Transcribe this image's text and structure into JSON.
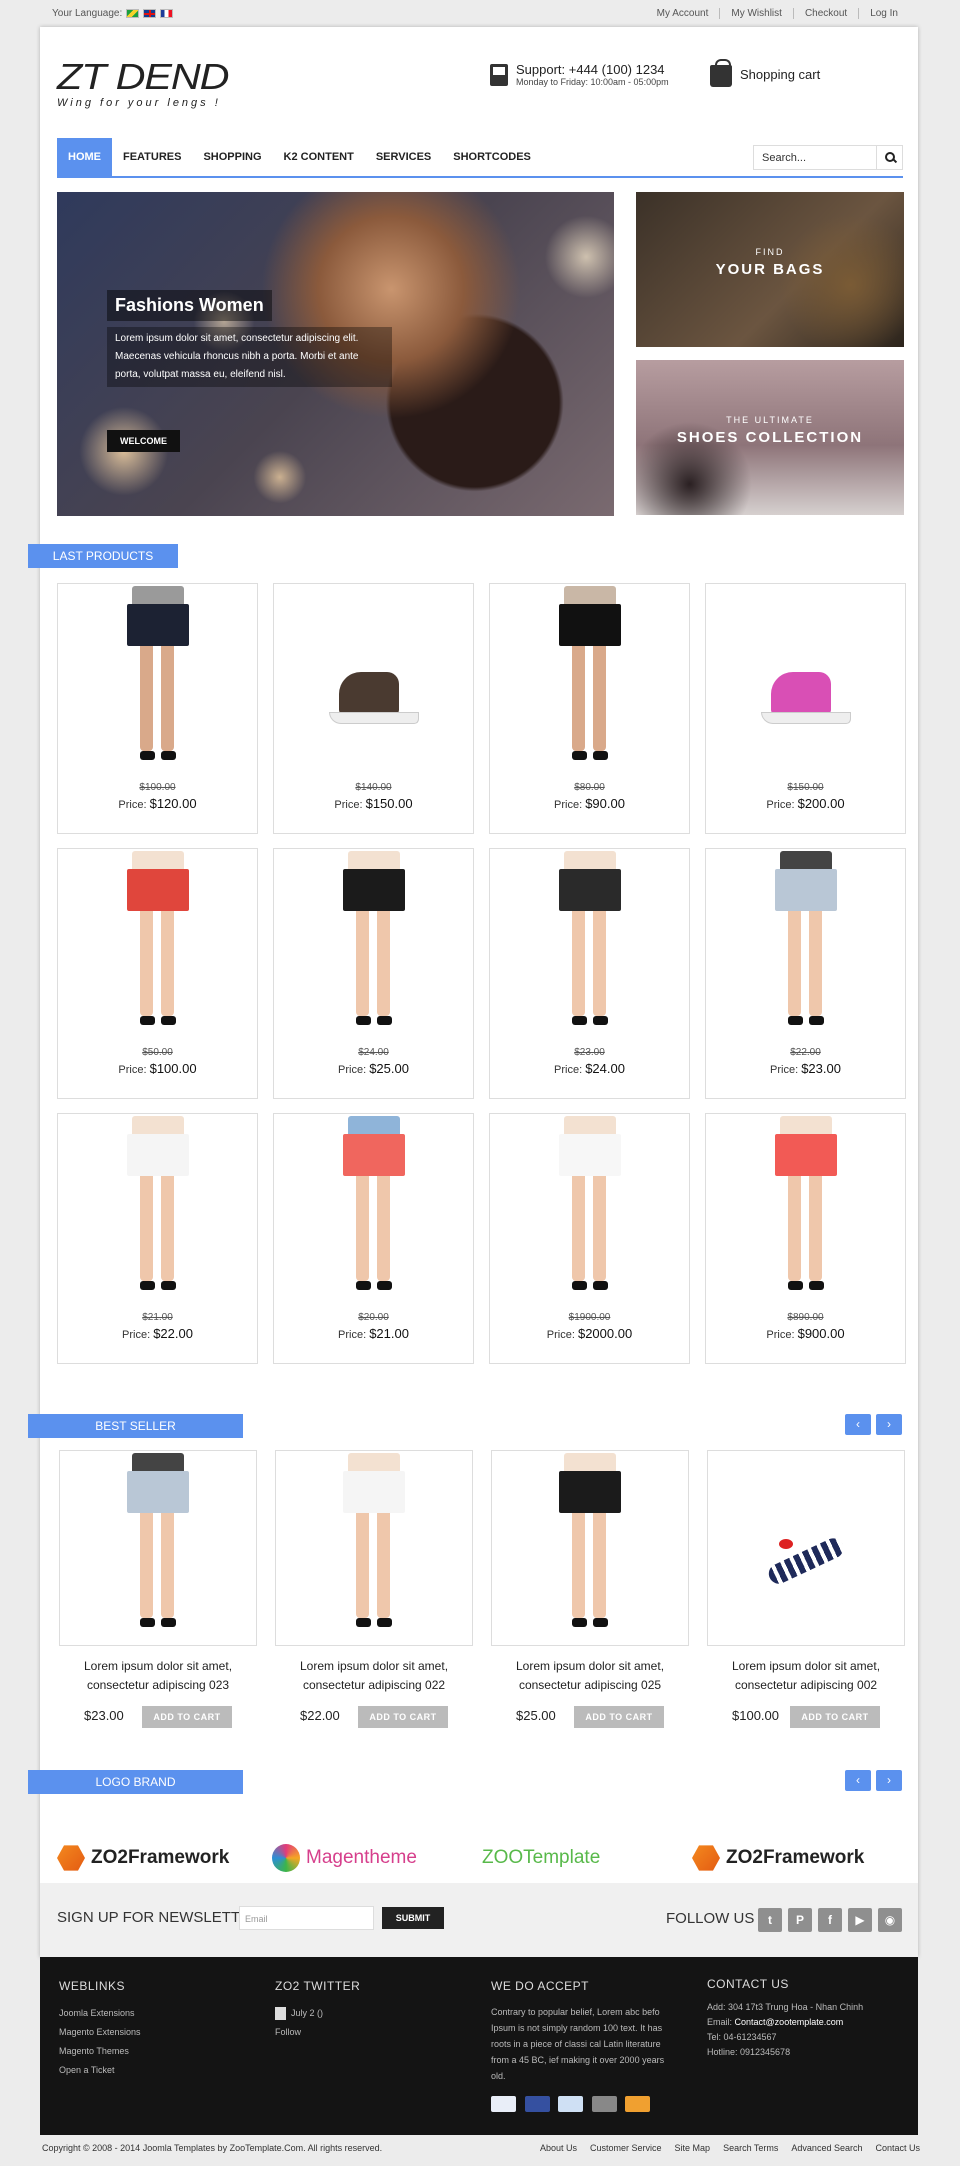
{
  "topbar": {
    "language_label": "Your Language:",
    "links": [
      "My Account",
      "My Wishlist",
      "Checkout",
      "Log In"
    ]
  },
  "header": {
    "logo_title": "ZT DEND",
    "logo_tagline": "Wing for your lengs !",
    "support_line": "Support: +444 (100) 1234",
    "support_hours": "Monday to Friday: 10:00am - 05:00pm",
    "cart_label": "Shopping cart"
  },
  "nav": {
    "items": [
      "HOME",
      "FEATURES",
      "SHOPPING",
      "K2 CONTENT",
      "SERVICES",
      "SHORTCODES"
    ],
    "active": "HOME",
    "search_placeholder": "Search..."
  },
  "hero": {
    "title": "Fashions Women",
    "text": "Lorem ipsum dolor sit amet, consectetur adipiscing elit. Maecenas vehicula rhoncus nibh a porta. Morbi et ante porta, volutpat massa eu, eleifend nisl.",
    "button": "WELCOME"
  },
  "promos": [
    {
      "small": "FIND",
      "large": "YOUR BAGS"
    },
    {
      "small": "THE ULTIMATE",
      "large": "SHOES COLLECTION"
    }
  ],
  "last_products": {
    "title": "LAST PRODUCTS",
    "price_label": "Price:",
    "items": [
      {
        "old": "$100.00",
        "price": "$120.00",
        "kind": "shorts",
        "top": "#9a9a9a",
        "bottom": "#1c2233",
        "skin": "#d9a98a"
      },
      {
        "old": "$140.00",
        "price": "$150.00",
        "kind": "shoe",
        "color": "#4a3a30"
      },
      {
        "old": "$80.00",
        "price": "$90.00",
        "kind": "shorts",
        "top": "#c9b7a6",
        "bottom": "#111",
        "skin": "#d9a98a"
      },
      {
        "old": "$150.00",
        "price": "$200.00",
        "kind": "shoe",
        "color": "#d94fb5"
      },
      {
        "old": "$50.00",
        "price": "$100.00",
        "kind": "shorts",
        "top": "#f3e1d1",
        "bottom": "#e0463c",
        "skin": "#efc7ab"
      },
      {
        "old": "$24.00",
        "price": "$25.00",
        "kind": "shorts",
        "top": "#f3e1d1",
        "bottom": "#1b1b1b",
        "skin": "#efc7ab"
      },
      {
        "old": "$23.00",
        "price": "$24.00",
        "kind": "shorts",
        "top": "#f3e1d1",
        "bottom": "#2a2a2a",
        "skin": "#efc7ab"
      },
      {
        "old": "$22.00",
        "price": "$23.00",
        "kind": "shorts",
        "top": "#444",
        "bottom": "#b9c7d6",
        "skin": "#efc7ab"
      },
      {
        "old": "$21.00",
        "price": "$22.00",
        "kind": "shorts",
        "top": "#f3e1d1",
        "bottom": "#f5f5f5",
        "skin": "#efc7ab"
      },
      {
        "old": "$20.00",
        "price": "$21.00",
        "kind": "shorts",
        "top": "#8fb4d9",
        "bottom": "#f0665e",
        "skin": "#efc7ab"
      },
      {
        "old": "$1900.00",
        "price": "$2000.00",
        "kind": "shorts",
        "top": "#f3e1d1",
        "bottom": "#f7f7f7",
        "skin": "#efc7ab"
      },
      {
        "old": "$890.00",
        "price": "$900.00",
        "kind": "shorts",
        "top": "#f3e1d1",
        "bottom": "#f25a55",
        "skin": "#efc7ab"
      }
    ]
  },
  "best_seller": {
    "title": "BEST SELLER",
    "button": "ADD TO CART",
    "items": [
      {
        "name": "Lorem ipsum dolor sit amet, consectetur adipiscing 023",
        "price": "$23.00",
        "kind": "shorts",
        "top": "#444",
        "bottom": "#b9c7d6",
        "skin": "#efc7ab"
      },
      {
        "name": "Lorem ipsum dolor sit amet, consectetur adipiscing 022",
        "price": "$22.00",
        "kind": "shorts",
        "top": "#f3e1d1",
        "bottom": "#f5f5f5",
        "skin": "#efc7ab"
      },
      {
        "name": "Lorem ipsum dolor sit amet, consectetur adipiscing 025",
        "price": "$25.00",
        "kind": "shorts",
        "top": "#f3e1d1",
        "bottom": "#1b1b1b",
        "skin": "#efc7ab"
      },
      {
        "name": "Lorem ipsum dolor sit amet, consectetur adipiscing 002",
        "price": "$100.00",
        "kind": "sandal"
      }
    ]
  },
  "logo_brand": {
    "title": "LOGO BRAND",
    "brands": [
      {
        "name": "ZO2Framework",
        "color": "#222",
        "icon": "hex"
      },
      {
        "name": "Magentheme",
        "color": "#d63f8c",
        "icon": "circle"
      },
      {
        "name": "ZOOTemplate",
        "color": "#58b94a",
        "icon": "none"
      },
      {
        "name": "ZO2Framework",
        "color": "#222",
        "icon": "hex"
      }
    ]
  },
  "newsletter": {
    "title": "SIGN UP FOR NEWSLETTER",
    "placeholder": "Email",
    "button": "SUBMIT",
    "follow": "FOLLOW US",
    "social": [
      "twitter-icon",
      "pinterest-icon",
      "facebook-icon",
      "youtube-icon",
      "rss-icon"
    ]
  },
  "footer": {
    "weblinks": {
      "title": "WEBLINKS",
      "items": [
        "Joomla Extensions",
        "Magento Extensions",
        "Magento Themes",
        "Open a Ticket"
      ]
    },
    "twitter": {
      "title": "ZO2 TWITTER",
      "date": "July 2 ()",
      "follow": "Follow"
    },
    "accept": {
      "title": "WE DO ACCEPT",
      "text": "Contrary to popular belief, Lorem abc befo Ipsum is not simply random 100 text. It has roots in a piece of classi cal Latin literature from a 45 BC, ief making it over 2000 years old."
    },
    "contact": {
      "title": "CONTACT US",
      "address": "Add: 304 17t3 Trung Hoa - Nhan Chinh",
      "email_label": "Email:",
      "email": "Contact@zootemplate.com",
      "tel": "Tel: 04-61234567",
      "hotline": "Hotline: 0912345678"
    }
  },
  "bottom": {
    "copyright": "Copyright © 2008 - 2014 Joomla Templates by ZooTemplate.Com. All rights reserved.",
    "links": [
      "About Us",
      "Customer Service",
      "Site Map",
      "Search Terms",
      "Advanced Search",
      "Contact Us"
    ]
  },
  "colors": {
    "accent": "#5b91ee",
    "footer_bg": "#141414"
  }
}
